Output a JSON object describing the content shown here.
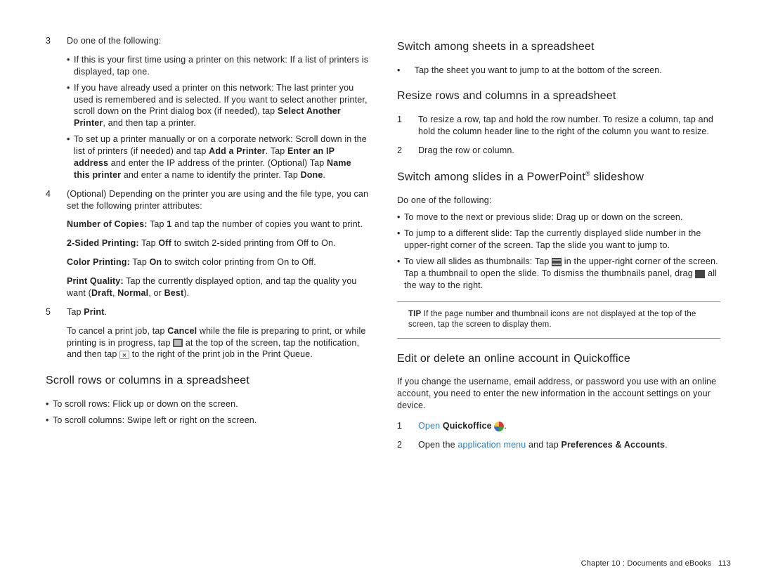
{
  "left": {
    "step3_num": "3",
    "step3_lead": "Do one of the following:",
    "step3_b1a": "If this is your first time using a printer on this network: If a list of printers is displayed, tap one.",
    "step3_b2a": "If you have already used a printer on this network: The last printer you used is remembered and is selected. If you want to select another printer, scroll down on the Print dialog box (if needed), tap ",
    "step3_b2b": "Select Another Printer",
    "step3_b2c": ", and then tap a printer.",
    "step3_b3a": "To set up a printer manually or on a corporate network: Scroll down in the list of printers (if needed) and tap ",
    "step3_b3b": "Add a Printer",
    "step3_b3c": ". Tap ",
    "step3_b3d": "Enter an IP address",
    "step3_b3e": " and enter the IP address of the printer. (Optional) Tap ",
    "step3_b3f": "Name this printer",
    "step3_b3g": " and enter a name to identify the printer. Tap ",
    "step3_b3h": "Done",
    "step3_b3i": ".",
    "step4_num": "4",
    "step4_body": "(Optional) Depending on the printer you are using and the file type, you can set the following printer attributes:",
    "attr1a": "Number of Copies:",
    "attr1b": " Tap ",
    "attr1c": "1",
    "attr1d": " and tap the number of copies you want to print.",
    "attr2a": "2-Sided Printing:",
    "attr2b": " Tap ",
    "attr2c": "Off",
    "attr2d": " to switch 2-sided printing from Off to On.",
    "attr3a": "Color Printing:",
    "attr3b": " Tap ",
    "attr3c": "On",
    "attr3d": " to switch color printing from On to Off.",
    "attr4a": "Print Quality:",
    "attr4b": " Tap the currently displayed option, and tap the quality you want (",
    "attr4c": "Draft",
    "attr4d": ", ",
    "attr4e": "Normal",
    "attr4f": ", or ",
    "attr4g": "Best",
    "attr4h": ").",
    "step5_num": "5",
    "step5a": "Tap ",
    "step5b": "Print",
    "step5c": ".",
    "cancel_a": "To cancel a print job, tap ",
    "cancel_b": "Cancel",
    "cancel_c": " while the file is preparing to print, or while printing is in progress, tap ",
    "cancel_d": " at the top of the screen, tap the notification, and then tap ",
    "cancel_e": " to the right of the print job in the Print Queue.",
    "h_scroll": "Scroll rows or columns in a spreadsheet",
    "scroll_b1": "To scroll rows: Flick up or down on the screen.",
    "scroll_b2": "To scroll columns: Swipe left or right on the screen."
  },
  "right": {
    "h_switch_sheets": "Switch among sheets in a spreadsheet",
    "switch_b1": "Tap the sheet you want to jump to at the bottom of the screen.",
    "h_resize": "Resize rows and columns in a spreadsheet",
    "resize1_num": "1",
    "resize1_body": "To resize a row, tap and hold the row number. To resize a column, tap and hold the column header line to the right of the column you want to resize.",
    "resize2_num": "2",
    "resize2_body": "Drag the row or column.",
    "h_slides_a": "Switch among slides in a PowerPoint",
    "h_slides_b": " slideshow",
    "slides_lead": "Do one of the following:",
    "slides_b1": "To move to the next or previous slide: Drag up or down on the screen.",
    "slides_b2": "To jump to a different slide: Tap the currently displayed slide number in the upper-right corner of the screen. Tap the slide you want to jump to.",
    "slides_b3a": "To view all slides as thumbnails: Tap ",
    "slides_b3b": " in the upper-right corner of the screen. Tap a thumbnail to open the slide. To dismiss the thumbnails panel, drag ",
    "slides_b3c": " all the way to the right.",
    "tip_label": "TIP",
    "tip_body": " If the page number and thumbnail icons are not displayed at the top of the screen, tap the screen to display them.",
    "h_edit": "Edit or delete an online account in Quickoffice",
    "edit_para": "If you change the username, email address, or password you use with an online account, you need to enter the new information in the account settings on your device.",
    "edit1_num": "1",
    "edit1_a": "Open",
    "edit1_b": " Quickoffice",
    "edit1_c": " ",
    "edit1_d": ".",
    "edit2_num": "2",
    "edit2_a": "Open the ",
    "edit2_b": "application menu",
    "edit2_c": " and tap ",
    "edit2_d": "Preferences & Accounts",
    "edit2_e": "."
  },
  "footer": {
    "chapter": "Chapter 10 : Documents and eBooks",
    "page": "113"
  }
}
